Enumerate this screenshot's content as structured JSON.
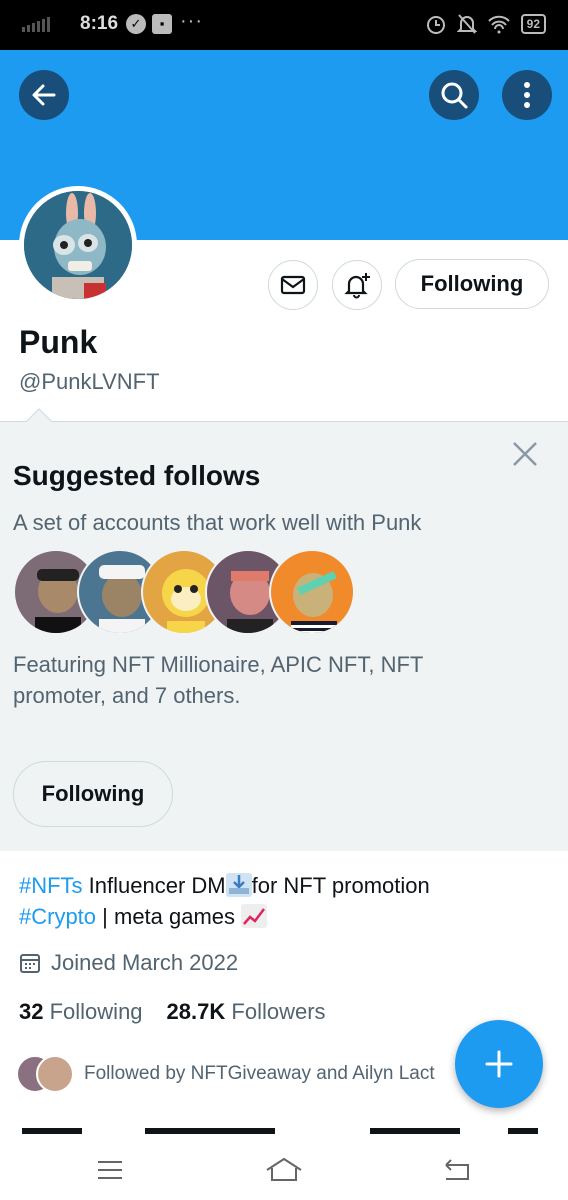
{
  "status_bar": {
    "time": "8:16",
    "battery": "92"
  },
  "profile": {
    "display_name": "Punk",
    "handle": "@PunkLVNFT",
    "following_button": "Following"
  },
  "suggested": {
    "title": "Suggested follows",
    "subtitle": "A set of accounts that work well with Punk",
    "featuring": "Featuring NFT Millionaire, APIC NFT, NFT promoter, and 7 others.",
    "follow_button": "Following"
  },
  "bio": {
    "tag1": "#NFTs",
    "text1": " Influencer DM",
    "text2": "for NFT promotion",
    "tag2": "#Crypto",
    "text3": " | meta games "
  },
  "joined": "Joined March 2022",
  "stats": {
    "following_count": "32",
    "following_label": "Following",
    "followers_count": "28.7K",
    "followers_label": "Followers"
  },
  "followed_by": "Followed by NFTGiveaway and Ailyn Lact",
  "colors": {
    "brand": "#1d9bf0",
    "text": "#0f1419",
    "muted": "#536471",
    "panel": "#eff3f4"
  }
}
